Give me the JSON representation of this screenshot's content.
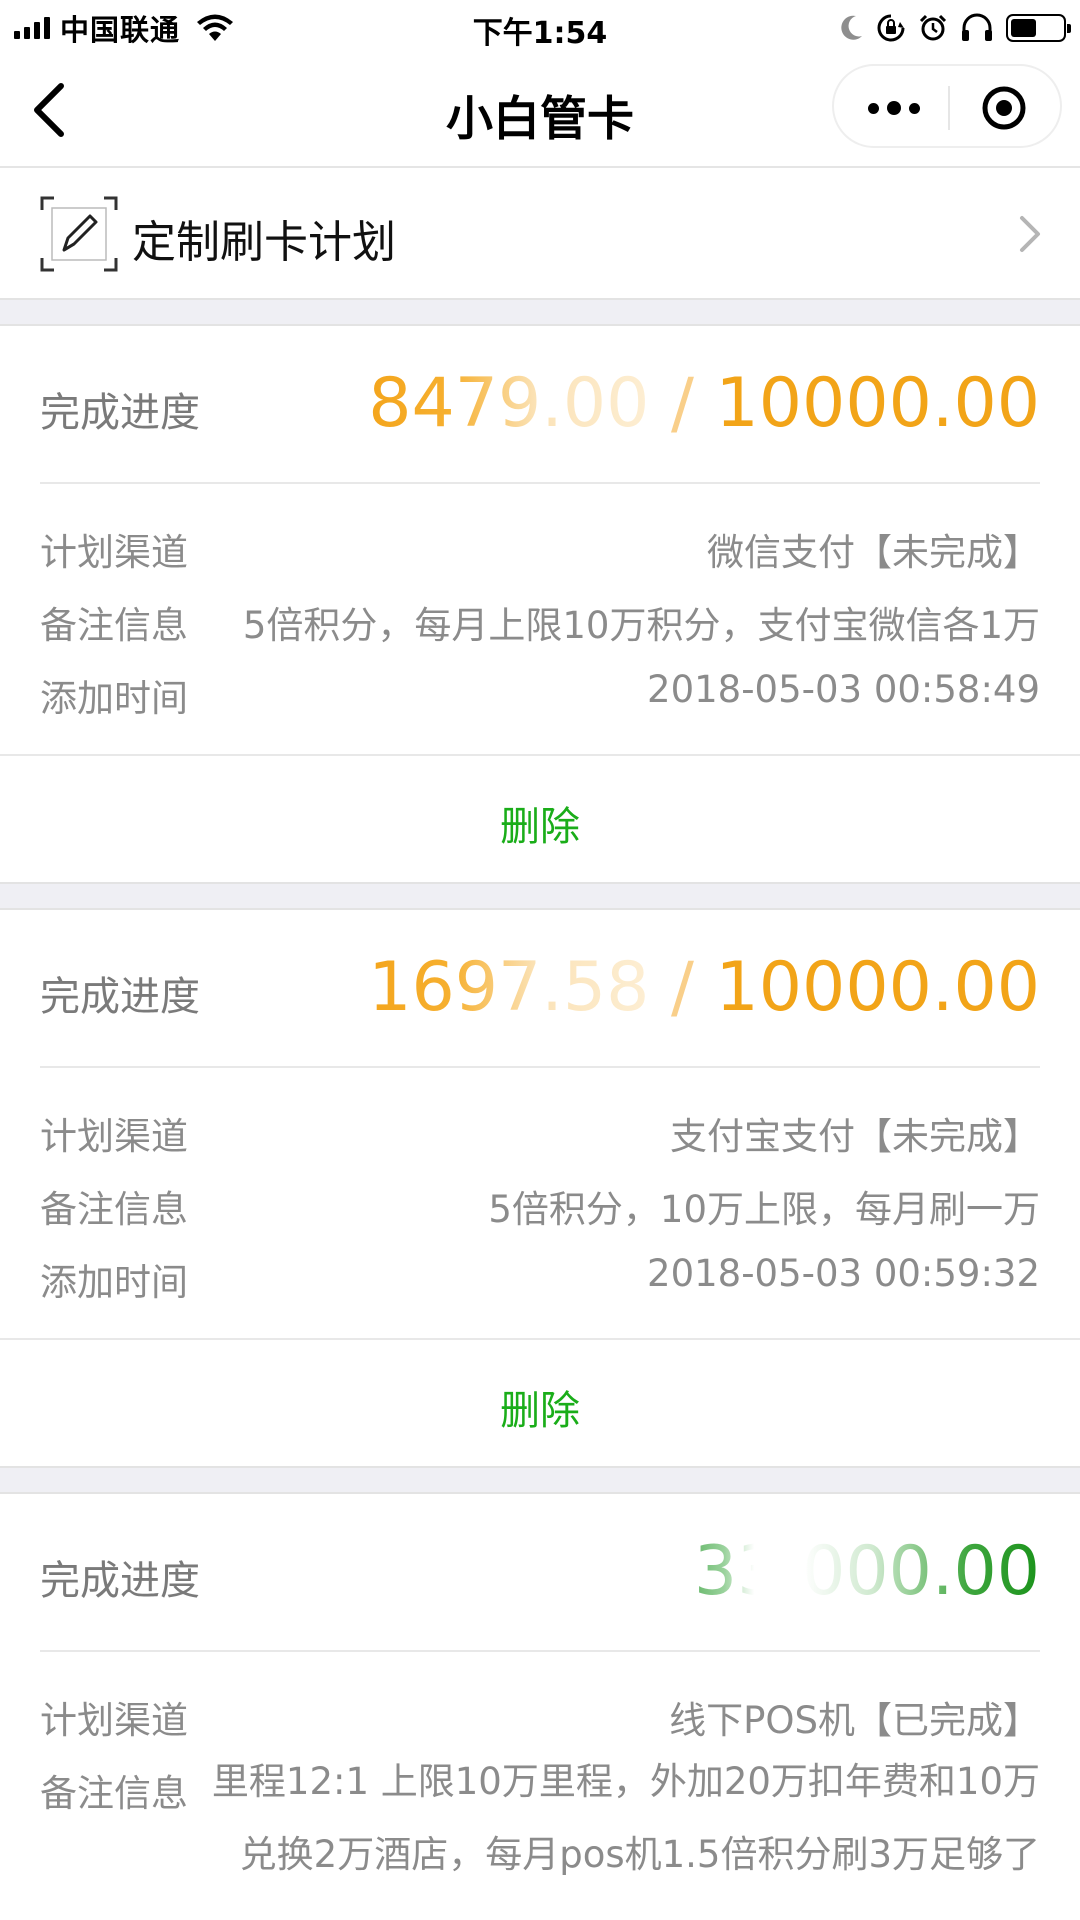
{
  "status_bar": {
    "carrier": "中国联通",
    "time": "下午1:54",
    "battery_level": 0.5
  },
  "nav": {
    "title": "小白管卡"
  },
  "plan_entry": {
    "label": "定制刷卡计划"
  },
  "labels": {
    "progress": "完成进度",
    "channel": "计划渠道",
    "note": "备注信息",
    "added": "添加时间",
    "delete": "删除"
  },
  "cards": [
    {
      "done": "8479.00",
      "sep": " / ",
      "total": "10000.00",
      "channel": "微信支付【未完成】",
      "note": "5倍积分，每月上限10万积分，支付宝微信各1万",
      "added": "2018-05-03 00:58:49"
    },
    {
      "done": "1697.58",
      "sep": " / ",
      "total": "10000.00",
      "channel": "支付宝支付【未完成】",
      "note": "5倍积分，10万上限，每月刷一万",
      "added": "2018-05-03 00:59:32"
    },
    {
      "done": "33",
      "sep": "   ",
      "total": "000.00",
      "channel": "线下POS机【已完成】",
      "note": "里程12:1 上限10万里程，外加20万扣年费和10万兑换2万酒店，每月pos机1.5倍积分刷3万足够了"
    }
  ],
  "colors": {
    "accent_orange": "#f2a418",
    "accent_green": "#1aad19",
    "label_gray": "#8b8b8b",
    "divider": "#e8e8e8",
    "gap_bg": "#efeff4"
  },
  "icons": [
    "signal-icon",
    "wifi-icon",
    "moon-icon",
    "orientation-lock-icon",
    "alarm-icon",
    "headphones-icon",
    "battery-icon",
    "back-arrow-icon",
    "more-icon",
    "close-target-icon",
    "pen-edit-icon",
    "chevron-right-icon"
  ]
}
